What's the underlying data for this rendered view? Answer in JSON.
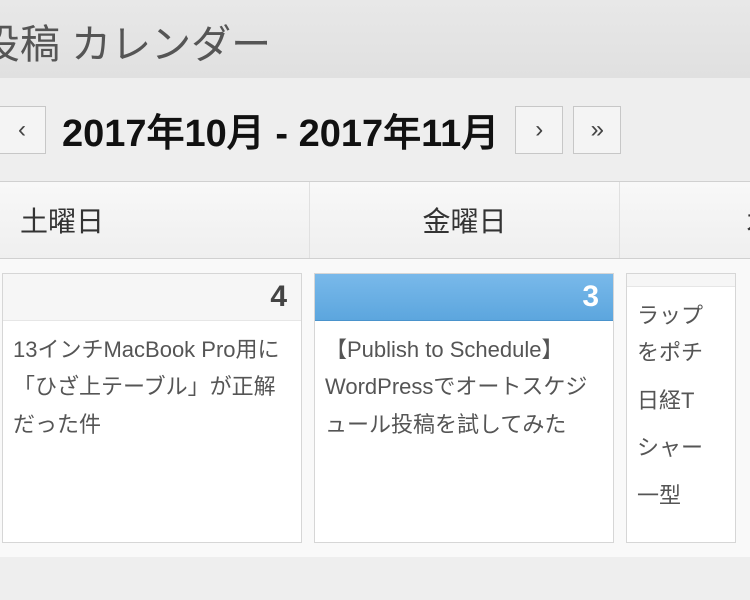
{
  "page_title": "投稿 カレンダー",
  "nav": {
    "prev": "‹",
    "range": "2017年10月 - 2017年11月",
    "next": "›",
    "fwd": "»"
  },
  "days": {
    "col1": "土曜日",
    "col2": "金曜日",
    "col3": "木曜"
  },
  "cells": {
    "c1": {
      "date": "4",
      "post1": "13インチMacBook Pro用に「ひざ上テーブル」が正解だった件"
    },
    "c2": {
      "date": "3",
      "post1": "【Publish to Schedule】WordPressでオートスケジュール投稿を試してみた"
    },
    "c3": {
      "post1": "ラップ",
      "post1b": "をポチ",
      "post2": "日経T",
      "post3": "シャー",
      "post4": "一型"
    }
  }
}
